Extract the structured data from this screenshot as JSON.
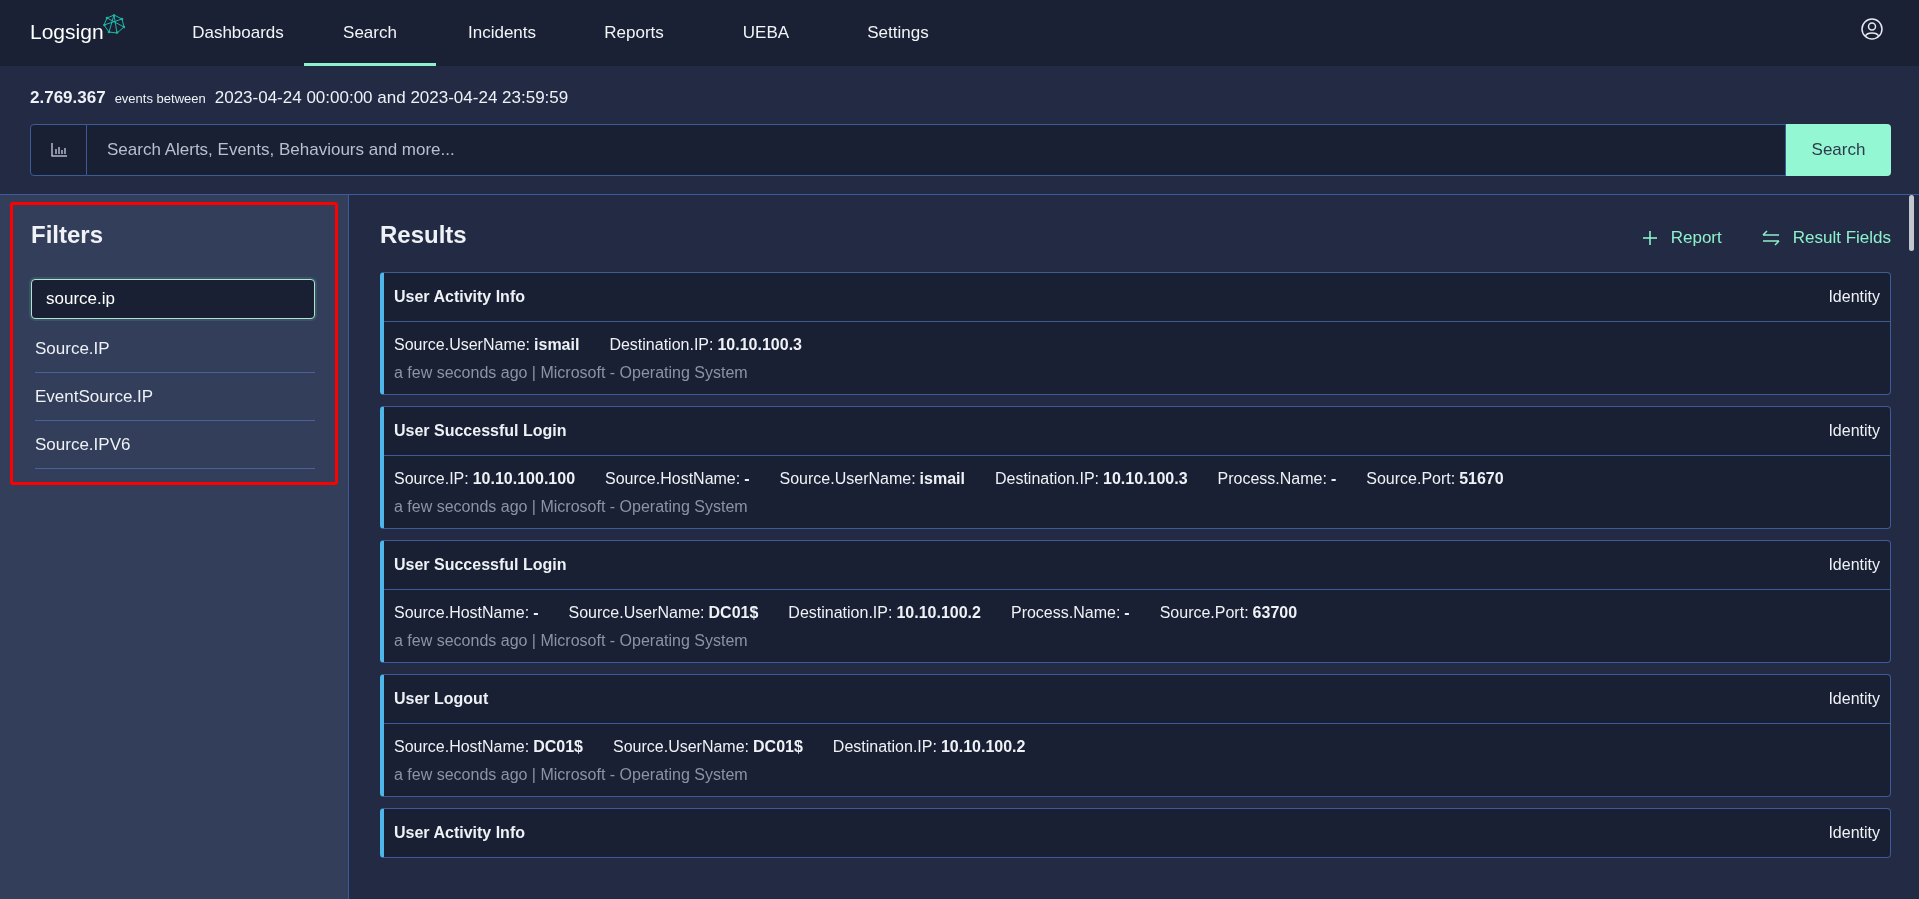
{
  "brand": {
    "name": "Logsign"
  },
  "nav": [
    {
      "label": "Dashboards",
      "selected": false
    },
    {
      "label": "Search",
      "selected": true
    },
    {
      "label": "Incidents",
      "selected": false
    },
    {
      "label": "Reports",
      "selected": false
    },
    {
      "label": "UEBA",
      "selected": false
    },
    {
      "label": "Settings",
      "selected": false
    }
  ],
  "summary": {
    "count": "2.769.367",
    "text": "events between",
    "range": "2023-04-24 00:00:00 and 2023-04-24 23:59:59"
  },
  "search": {
    "placeholder": "Search Alerts, Events, Behaviours and more...",
    "button": "Search"
  },
  "filters": {
    "title": "Filters",
    "highlighted": true,
    "query": "source.ip",
    "options": [
      "Source.IP",
      "EventSource.IP",
      "Source.IPV6"
    ]
  },
  "results": {
    "title": "Results",
    "actions": [
      "Report",
      "Result Fields"
    ],
    "items": [
      {
        "title": "User Activity Info",
        "category": "Identity",
        "fields": [
          {
            "name": "Source.UserName:",
            "value": "ismail"
          },
          {
            "name": "Destination.IP:",
            "value": "10.10.100.3"
          }
        ],
        "meta": "a few seconds ago | Microsoft - Operating System"
      },
      {
        "title": "User Successful Login",
        "category": "Identity",
        "fields": [
          {
            "name": "Source.IP:",
            "value": "10.10.100.100"
          },
          {
            "name": "Source.HostName:",
            "value": "-"
          },
          {
            "name": "Source.UserName:",
            "value": "ismail"
          },
          {
            "name": "Destination.IP:",
            "value": "10.10.100.3"
          },
          {
            "name": "Process.Name:",
            "value": "-"
          },
          {
            "name": "Source.Port:",
            "value": "51670"
          }
        ],
        "meta": "a few seconds ago | Microsoft - Operating System"
      },
      {
        "title": "User Successful Login",
        "category": "Identity",
        "fields": [
          {
            "name": "Source.HostName:",
            "value": "-"
          },
          {
            "name": "Source.UserName:",
            "value": "DC01$"
          },
          {
            "name": "Destination.IP:",
            "value": "10.10.100.2"
          },
          {
            "name": "Process.Name:",
            "value": "-"
          },
          {
            "name": "Source.Port:",
            "value": "63700"
          }
        ],
        "meta": "a few seconds ago | Microsoft - Operating System"
      },
      {
        "title": "User Logout",
        "category": "Identity",
        "fields": [
          {
            "name": "Source.HostName:",
            "value": "DC01$"
          },
          {
            "name": "Source.UserName:",
            "value": "DC01$"
          },
          {
            "name": "Destination.IP:",
            "value": "10.10.100.2"
          }
        ],
        "meta": "a few seconds ago | Microsoft - Operating System"
      },
      {
        "title": "User Activity Info",
        "category": "Identity"
      }
    ]
  }
}
